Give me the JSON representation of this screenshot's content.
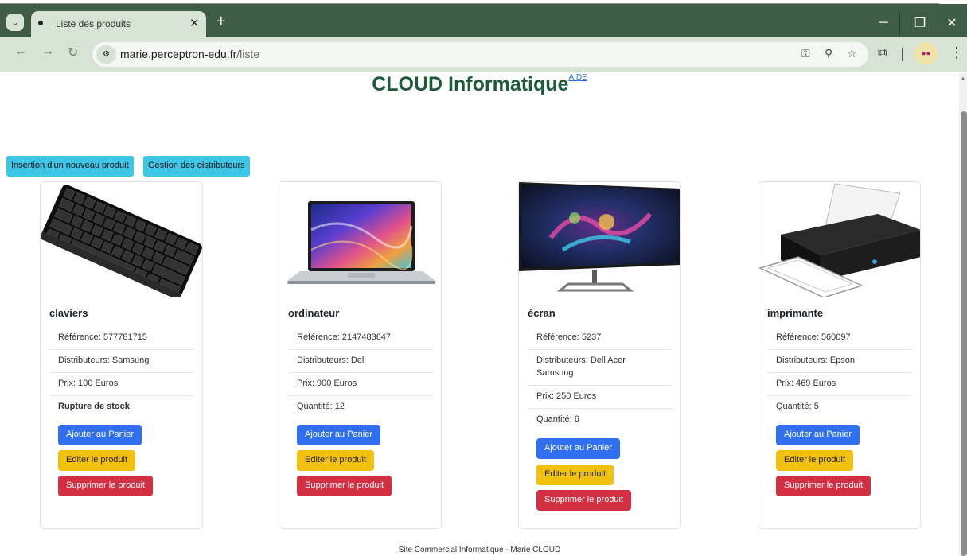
{
  "browser": {
    "tab_title": "Liste des produits",
    "url_host": "marie.perceptron-edu.fr",
    "url_path": "/liste"
  },
  "site": {
    "title": "CLOUD Informatique",
    "help_link": "AIDE",
    "actions": {
      "insert_product": "Insertion d'un nouveau produit",
      "manage_distributors": "Gestion des distributeurs"
    },
    "footer": "Site Commercial Informatique - Marie CLOUD"
  },
  "products": [
    {
      "name": "claviers",
      "image": "keyboard-image",
      "reference": "Référence: 577781715",
      "distributors": "Distributeurs: Samsung",
      "price": "Prix: 100 Euros",
      "stock": "Rupture de stock",
      "add_to_cart": "Ajouter au Panier",
      "edit": "Editer le produit",
      "delete": "Supprimer le produit"
    },
    {
      "name": "ordinateur",
      "image": "laptop-image",
      "reference": "Référence: 2147483647",
      "distributors": "Distributeurs: Dell",
      "price": "Prix: 900 Euros",
      "stock": "Quantité: 12",
      "add_to_cart": "Ajouter au Panier",
      "edit": "Editer le produit",
      "delete": "Supprimer le produit"
    },
    {
      "name": "écran",
      "image": "monitor-image",
      "reference": "Référence: 5237",
      "distributors": "Distributeurs: Dell  Acer Samsung",
      "price": "Prix: 250 Euros",
      "stock": "Quantité: 6",
      "add_to_cart": "Ajouter au Panier",
      "edit": "Editer le produit",
      "delete": "Supprimer le produit"
    },
    {
      "name": "imprimante",
      "image": "printer-image",
      "reference": "Référence: 560097",
      "distributors": "Distributeurs: Epson",
      "price": "Prix: 469 Euros",
      "stock": "Quantité: 5",
      "add_to_cart": "Ajouter au Panier",
      "edit": "Editer le produit",
      "delete": "Supprimer le produit"
    }
  ],
  "colors": {
    "tab_bar": "#3f5c44",
    "toolbar": "#d7e3d4",
    "brand_title": "#1d5a3a",
    "info_button": "#3ec6e6",
    "primary_button": "#2f6ff0",
    "warning_button": "#f2c10f",
    "danger_button": "#d32f42"
  }
}
